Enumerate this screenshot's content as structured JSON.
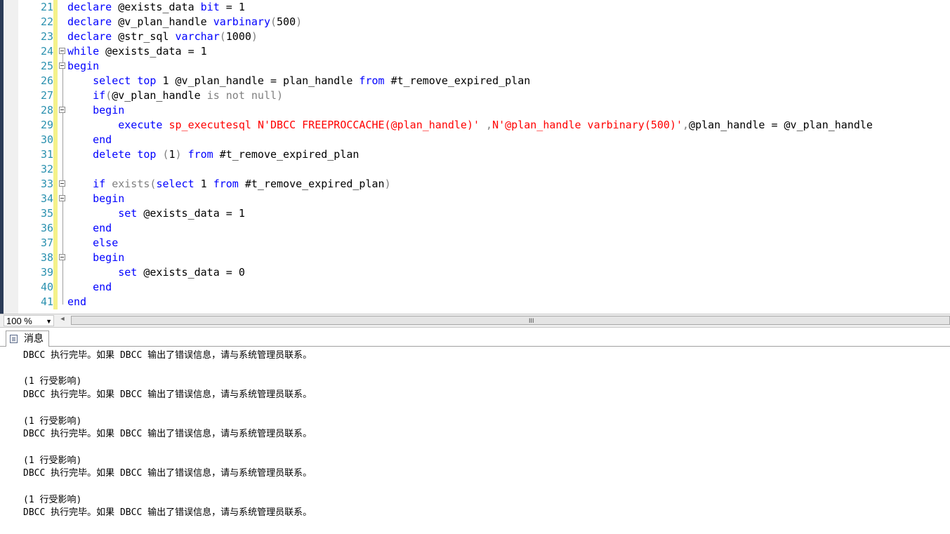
{
  "editor": {
    "lines": [
      {
        "num": "21",
        "fold": false,
        "segments": [
          {
            "t": "declare",
            "c": "kw"
          },
          {
            "t": " @exists_data "
          },
          {
            "t": "bit",
            "c": "kw"
          },
          {
            "t": " = 1"
          }
        ]
      },
      {
        "num": "22",
        "fold": false,
        "segments": [
          {
            "t": "declare",
            "c": "kw"
          },
          {
            "t": " @v_plan_handle "
          },
          {
            "t": "varbinary",
            "c": "kw"
          },
          {
            "t": "(",
            "c": "gy"
          },
          {
            "t": "500"
          },
          {
            "t": ")",
            "c": "gy"
          }
        ]
      },
      {
        "num": "23",
        "fold": false,
        "segments": [
          {
            "t": "declare",
            "c": "kw"
          },
          {
            "t": " @str_sql "
          },
          {
            "t": "varchar",
            "c": "kw"
          },
          {
            "t": "(",
            "c": "gy"
          },
          {
            "t": "1000"
          },
          {
            "t": ")",
            "c": "gy"
          }
        ]
      },
      {
        "num": "24",
        "fold": true,
        "segments": [
          {
            "t": "while",
            "c": "kw"
          },
          {
            "t": " @exists_data = 1"
          }
        ]
      },
      {
        "num": "25",
        "fold": true,
        "segments": [
          {
            "t": "begin",
            "c": "kw"
          }
        ]
      },
      {
        "num": "26",
        "fold": false,
        "segments": [
          {
            "t": "    "
          },
          {
            "t": "select",
            "c": "kw"
          },
          {
            "t": " "
          },
          {
            "t": "top",
            "c": "kw"
          },
          {
            "t": " 1 @v_plan_handle = plan_handle "
          },
          {
            "t": "from",
            "c": "kw"
          },
          {
            "t": " #t_remove_expired_plan"
          }
        ]
      },
      {
        "num": "27",
        "fold": false,
        "segments": [
          {
            "t": "    "
          },
          {
            "t": "if",
            "c": "kw"
          },
          {
            "t": "(",
            "c": "gy"
          },
          {
            "t": "@v_plan_handle "
          },
          {
            "t": "is not null",
            "c": "gy"
          },
          {
            "t": ")",
            "c": "gy"
          }
        ]
      },
      {
        "num": "28",
        "fold": true,
        "segments": [
          {
            "t": "    "
          },
          {
            "t": "begin",
            "c": "kw"
          }
        ]
      },
      {
        "num": "29",
        "fold": false,
        "segments": [
          {
            "t": "        "
          },
          {
            "t": "execute",
            "c": "kw"
          },
          {
            "t": " "
          },
          {
            "t": "sp_executesql",
            "c": "str"
          },
          {
            "t": " "
          },
          {
            "t": "N'DBCC FREEPROCCACHE(@plan_handle)'",
            "c": "str"
          },
          {
            "t": " ,",
            "c": "gy"
          },
          {
            "t": "N'@plan_handle varbinary(500)'",
            "c": "str"
          },
          {
            "t": ",",
            "c": "gy"
          },
          {
            "t": "@plan_handle = @v_plan_handle"
          }
        ]
      },
      {
        "num": "30",
        "fold": false,
        "segments": [
          {
            "t": "    "
          },
          {
            "t": "end",
            "c": "kw"
          }
        ]
      },
      {
        "num": "31",
        "fold": false,
        "segments": [
          {
            "t": "    "
          },
          {
            "t": "delete",
            "c": "kw"
          },
          {
            "t": " "
          },
          {
            "t": "top",
            "c": "kw"
          },
          {
            "t": " "
          },
          {
            "t": "(",
            "c": "gy"
          },
          {
            "t": "1"
          },
          {
            "t": ")",
            "c": "gy"
          },
          {
            "t": " "
          },
          {
            "t": "from",
            "c": "kw"
          },
          {
            "t": " #t_remove_expired_plan"
          }
        ]
      },
      {
        "num": "32",
        "fold": false,
        "segments": []
      },
      {
        "num": "33",
        "fold": true,
        "segments": [
          {
            "t": "    "
          },
          {
            "t": "if",
            "c": "kw"
          },
          {
            "t": " "
          },
          {
            "t": "exists",
            "c": "gy"
          },
          {
            "t": "(",
            "c": "gy"
          },
          {
            "t": "select",
            "c": "kw"
          },
          {
            "t": " 1 "
          },
          {
            "t": "from",
            "c": "kw"
          },
          {
            "t": " #t_remove_expired_plan"
          },
          {
            "t": ")",
            "c": "gy"
          }
        ]
      },
      {
        "num": "34",
        "fold": true,
        "segments": [
          {
            "t": "    "
          },
          {
            "t": "begin",
            "c": "kw"
          }
        ]
      },
      {
        "num": "35",
        "fold": false,
        "segments": [
          {
            "t": "        "
          },
          {
            "t": "set",
            "c": "kw"
          },
          {
            "t": " @exists_data = 1"
          }
        ]
      },
      {
        "num": "36",
        "fold": false,
        "segments": [
          {
            "t": "    "
          },
          {
            "t": "end",
            "c": "kw"
          }
        ]
      },
      {
        "num": "37",
        "fold": false,
        "segments": [
          {
            "t": "    "
          },
          {
            "t": "else",
            "c": "kw"
          }
        ]
      },
      {
        "num": "38",
        "fold": true,
        "segments": [
          {
            "t": "    "
          },
          {
            "t": "begin",
            "c": "kw"
          }
        ]
      },
      {
        "num": "39",
        "fold": false,
        "segments": [
          {
            "t": "        "
          },
          {
            "t": "set",
            "c": "kw"
          },
          {
            "t": " @exists_data = 0"
          }
        ]
      },
      {
        "num": "40",
        "fold": false,
        "segments": [
          {
            "t": "    "
          },
          {
            "t": "end",
            "c": "kw"
          }
        ]
      },
      {
        "num": "41",
        "fold": false,
        "segments": [
          {
            "t": "end",
            "c": "kw"
          }
        ]
      }
    ]
  },
  "statusbar": {
    "zoom": "100 %",
    "scroll_grip": "III"
  },
  "results": {
    "tab_label": "消息",
    "tab_icon": "message-icon",
    "messages": [
      "DBCC 执行完毕。如果 DBCC 输出了错误信息，请与系统管理员联系。",
      "",
      "(1 行受影响)",
      "DBCC 执行完毕。如果 DBCC 输出了错误信息，请与系统管理员联系。",
      "",
      "(1 行受影响)",
      "DBCC 执行完毕。如果 DBCC 输出了错误信息，请与系统管理员联系。",
      "",
      "(1 行受影响)",
      "DBCC 执行完毕。如果 DBCC 输出了错误信息，请与系统管理员联系。",
      "",
      "(1 行受影响)",
      "DBCC 执行完毕。如果 DBCC 输出了错误信息，请与系统管理员联系。"
    ]
  }
}
